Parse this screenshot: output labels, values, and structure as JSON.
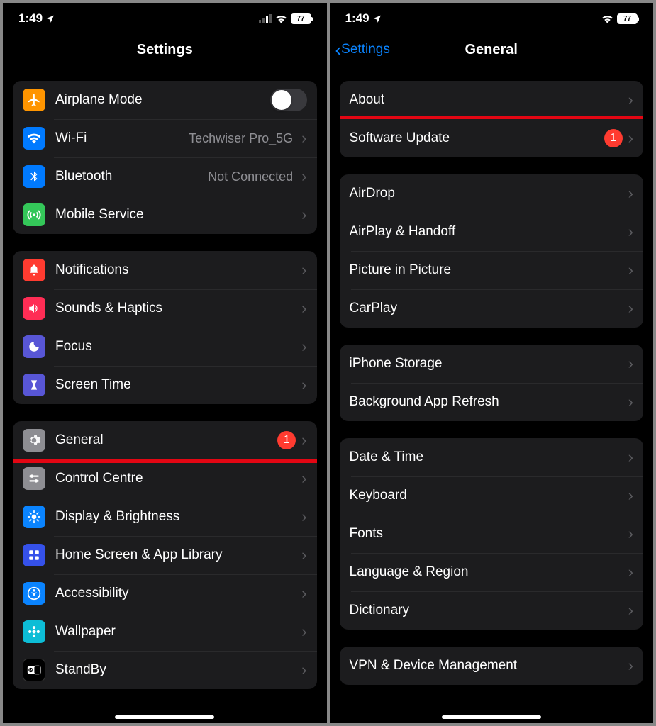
{
  "status": {
    "time": "1:49",
    "battery": "77"
  },
  "left": {
    "title": "Settings",
    "groups": [
      [
        {
          "icon": "airplane",
          "label": "Airplane Mode",
          "type": "toggle"
        },
        {
          "icon": "wifi",
          "label": "Wi-Fi",
          "value": "Techwiser Pro_5G",
          "type": "nav"
        },
        {
          "icon": "bluetooth",
          "label": "Bluetooth",
          "value": "Not Connected",
          "type": "nav"
        },
        {
          "icon": "mobile",
          "label": "Mobile Service",
          "type": "nav"
        }
      ],
      [
        {
          "icon": "notif",
          "label": "Notifications",
          "type": "nav"
        },
        {
          "icon": "sound",
          "label": "Sounds & Haptics",
          "type": "nav"
        },
        {
          "icon": "focus",
          "label": "Focus",
          "type": "nav"
        },
        {
          "icon": "screen",
          "label": "Screen Time",
          "type": "nav"
        }
      ],
      [
        {
          "icon": "general",
          "label": "General",
          "badge": "1",
          "type": "nav",
          "highlight": true
        },
        {
          "icon": "control",
          "label": "Control Centre",
          "type": "nav"
        },
        {
          "icon": "display",
          "label": "Display & Brightness",
          "type": "nav"
        },
        {
          "icon": "home",
          "label": "Home Screen & App Library",
          "type": "nav"
        },
        {
          "icon": "access",
          "label": "Accessibility",
          "type": "nav"
        },
        {
          "icon": "wall",
          "label": "Wallpaper",
          "type": "nav"
        },
        {
          "icon": "standby",
          "label": "StandBy",
          "type": "nav"
        }
      ]
    ]
  },
  "right": {
    "back": "Settings",
    "title": "General",
    "groups": [
      [
        {
          "label": "About",
          "type": "nav"
        },
        {
          "label": "Software Update",
          "badge": "1",
          "type": "nav",
          "highlight": true
        }
      ],
      [
        {
          "label": "AirDrop",
          "type": "nav"
        },
        {
          "label": "AirPlay & Handoff",
          "type": "nav"
        },
        {
          "label": "Picture in Picture",
          "type": "nav"
        },
        {
          "label": "CarPlay",
          "type": "nav"
        }
      ],
      [
        {
          "label": "iPhone Storage",
          "type": "nav"
        },
        {
          "label": "Background App Refresh",
          "type": "nav"
        }
      ],
      [
        {
          "label": "Date & Time",
          "type": "nav"
        },
        {
          "label": "Keyboard",
          "type": "nav"
        },
        {
          "label": "Fonts",
          "type": "nav"
        },
        {
          "label": "Language & Region",
          "type": "nav"
        },
        {
          "label": "Dictionary",
          "type": "nav"
        }
      ],
      [
        {
          "label": "VPN & Device Management",
          "type": "nav"
        }
      ]
    ]
  },
  "icons": {
    "airplane": "✈",
    "wifi": "wifi",
    "bluetooth": "bt",
    "mobile": "ant",
    "notif": "bell",
    "sound": "spk",
    "focus": "moon",
    "screen": "hour",
    "general": "gear",
    "control": "ctrl",
    "display": "sun",
    "home": "grid",
    "access": "acc",
    "wall": "flower",
    "standby": "clock"
  }
}
